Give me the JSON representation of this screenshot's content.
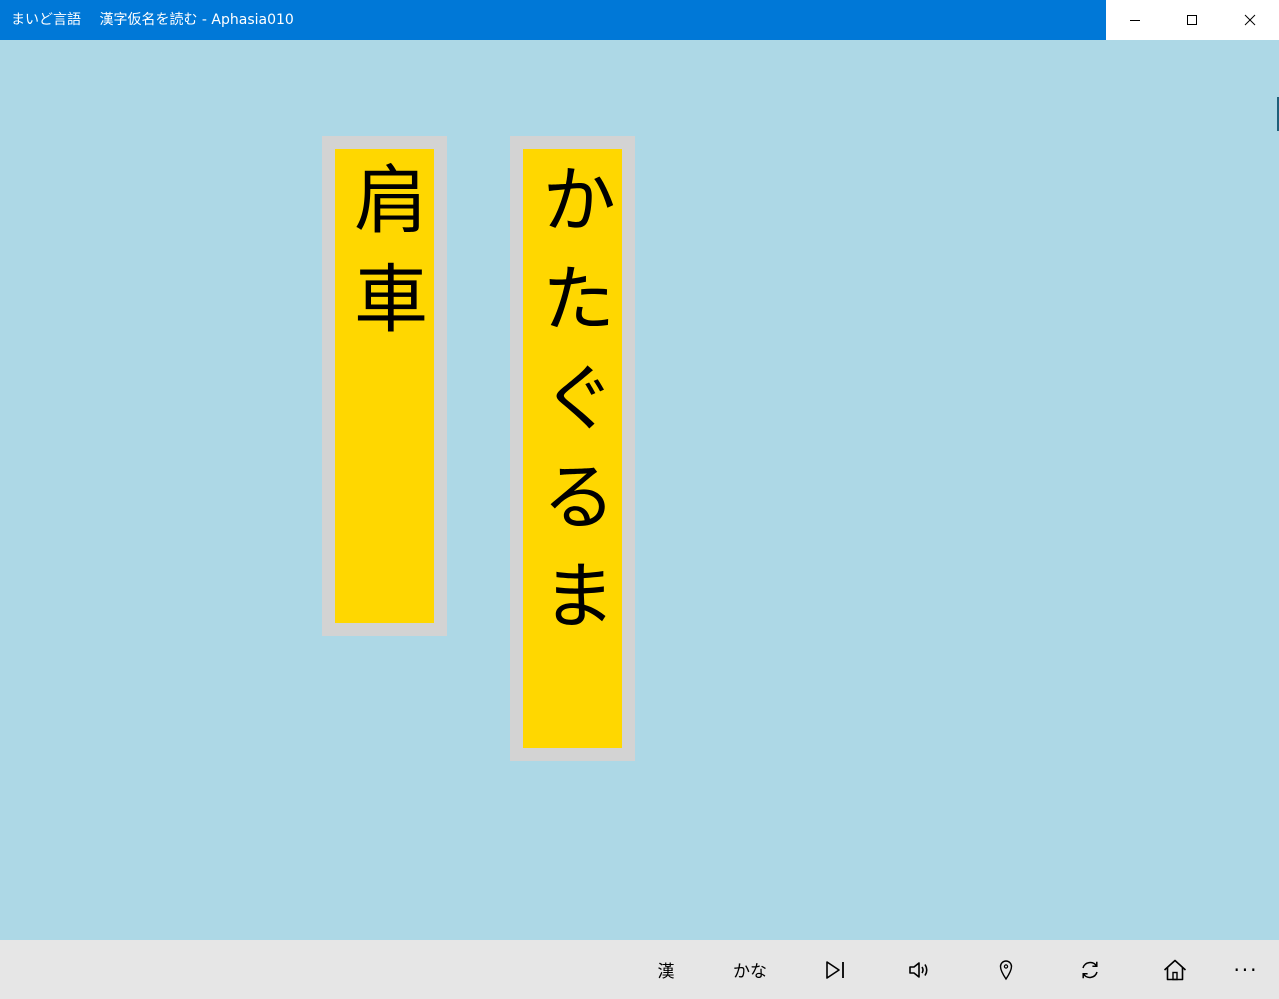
{
  "window": {
    "title": "まいど言語　 漢字仮名を読む - Aphasia010"
  },
  "cards": {
    "kanji": "肩車",
    "kana": "かたぐるま"
  },
  "appbar": {
    "kanji_label": "漢",
    "kana_label": "かな",
    "more_label": "···"
  },
  "colors": {
    "titlebar": "#0078d7",
    "background": "#add8e6",
    "card_border": "#d3d3d3",
    "card_fill": "#ffd700",
    "appbar": "#e6e6e6"
  },
  "icons": {
    "minimize": "minimize-icon",
    "maximize": "maximize-icon",
    "close": "close-icon",
    "next": "skip-next-icon",
    "speaker": "speaker-icon",
    "location": "map-pin-icon",
    "refresh": "refresh-icon",
    "home": "home-icon",
    "more": "more-icon"
  }
}
